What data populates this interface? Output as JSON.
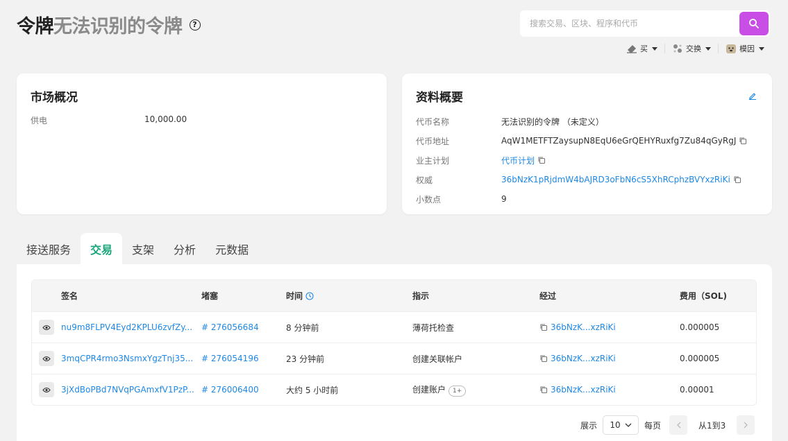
{
  "header": {
    "title_main": "令牌",
    "title_sub": "无法识别的令牌",
    "help_icon": "?"
  },
  "search": {
    "placeholder": "搜索交易、区块、程序和代币"
  },
  "toolbar": {
    "buy_label": "买",
    "exchange_label": "交换",
    "network_label": "模因"
  },
  "market": {
    "title": "市场概况",
    "rows": [
      {
        "key": "供电",
        "value": "10,000.00"
      }
    ]
  },
  "profile": {
    "title": "资料概要",
    "rows": [
      {
        "key": "代币名称",
        "value": "无法识别的令牌 （未定义）"
      },
      {
        "key": "代币地址",
        "value": "AqW1METFTZaysupN8EqU6eGrQEHYRuxfg7Zu84qGyRgJ"
      },
      {
        "key": "业主计划",
        "value": "代币计划"
      },
      {
        "key": "权威",
        "value": "36bNzK1pRjdmW4bAJRD3oFbN6cS5XhRCphzBVYxzRiKi"
      },
      {
        "key": "小数点",
        "value": "9"
      }
    ]
  },
  "tabs": [
    "接送服务",
    "交易",
    "支架",
    "分析",
    "元数据"
  ],
  "active_tab": 1,
  "table": {
    "headers": [
      "签名",
      "堵塞",
      "时间",
      "指示",
      "经过",
      "费用（SOL)"
    ],
    "rows": [
      {
        "signature": "nu9m8FLPV4Eyd2KPLU6zvfZy...",
        "block": "# 276056684",
        "time": "8 分钟前",
        "instruction": "薄荷托检查",
        "instruction_extra": "",
        "by": "36bNzK...xzRiKi",
        "fee": "0.000005"
      },
      {
        "signature": "3mqCPR4rmo3NsmxYgzTnj35...",
        "block": "# 276054196",
        "time": "23 分钟前",
        "instruction": "创建关联帐户",
        "instruction_extra": "",
        "by": "36bNzK...xzRiKi",
        "fee": "0.000005"
      },
      {
        "signature": "3jXdBoPBd7NVqPGAmxfV1PzP...",
        "block": "# 276006400",
        "time": "大约 5 小时前",
        "instruction": "创建账户",
        "instruction_extra": "1+",
        "by": "36bNzK...xzRiKi",
        "fee": "0.00001"
      }
    ]
  },
  "pager": {
    "show_label": "展示",
    "page_size": "10",
    "per_page_label": "每页",
    "range_label": "从1到3"
  },
  "colors": {
    "accent": "#c94ee6",
    "active_tab": "#1aa57a",
    "link": "#1e88e5"
  }
}
